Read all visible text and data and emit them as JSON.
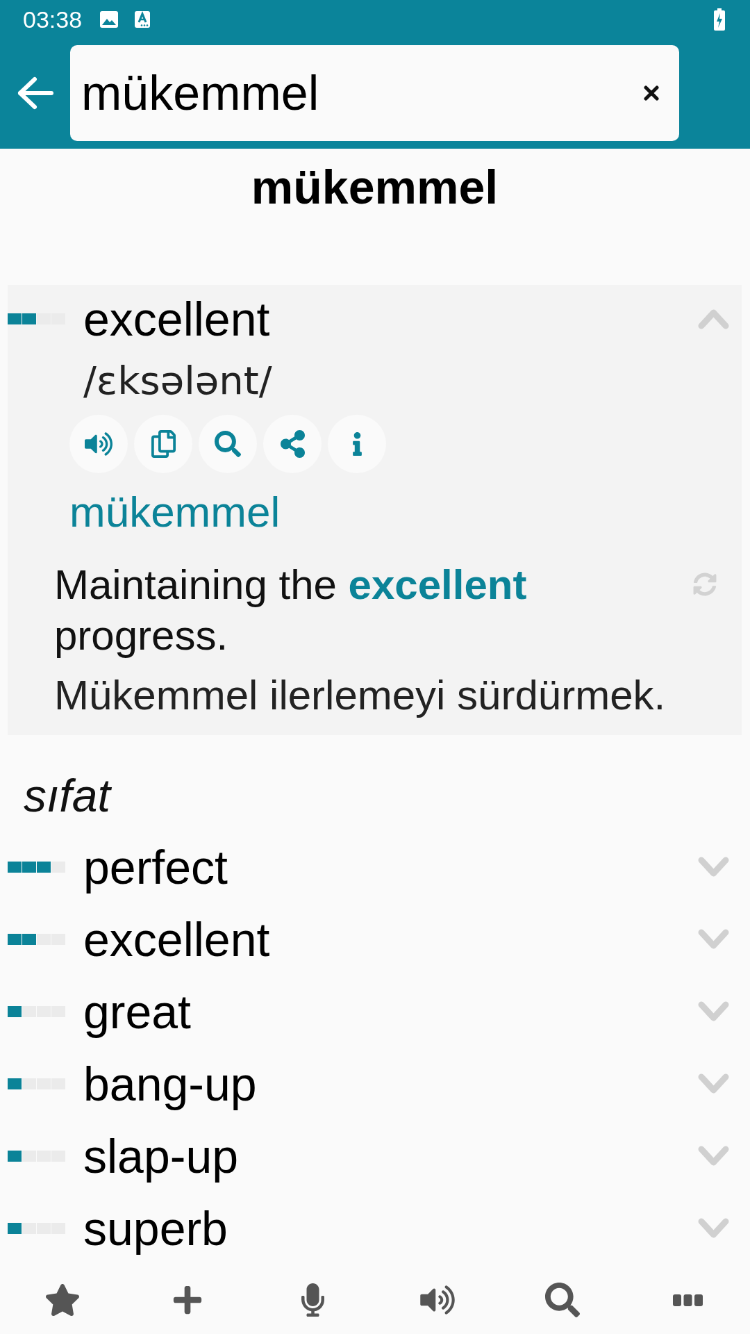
{
  "status_bar": {
    "time": "03:38"
  },
  "search": {
    "value": "mükemmel"
  },
  "headword": "mükemmel",
  "top_entry": {
    "word": "excellent",
    "level": 0.5,
    "expanded": true,
    "phonetic": "/ɛksələnt/",
    "translations": [
      "mükemmel"
    ],
    "example": {
      "text": "Maintaining the **excellent** progress.",
      "translation": "Mükemmel ilerlemeyi sürdürmek."
    }
  },
  "sections": [
    {
      "part_of_speech": "sıfat",
      "entries": [
        {
          "word": "perfect",
          "level": 0.75,
          "expanded": false
        },
        {
          "word": "excellent",
          "level": 0.5,
          "expanded": false
        },
        {
          "word": "great",
          "level": 0.25,
          "expanded": false
        },
        {
          "word": "bang-up",
          "level": 0.25,
          "expanded": false
        },
        {
          "word": "slap-up",
          "level": 0.25,
          "expanded": false
        },
        {
          "word": "superb",
          "level": 0.25,
          "expanded": false
        }
      ]
    }
  ]
}
